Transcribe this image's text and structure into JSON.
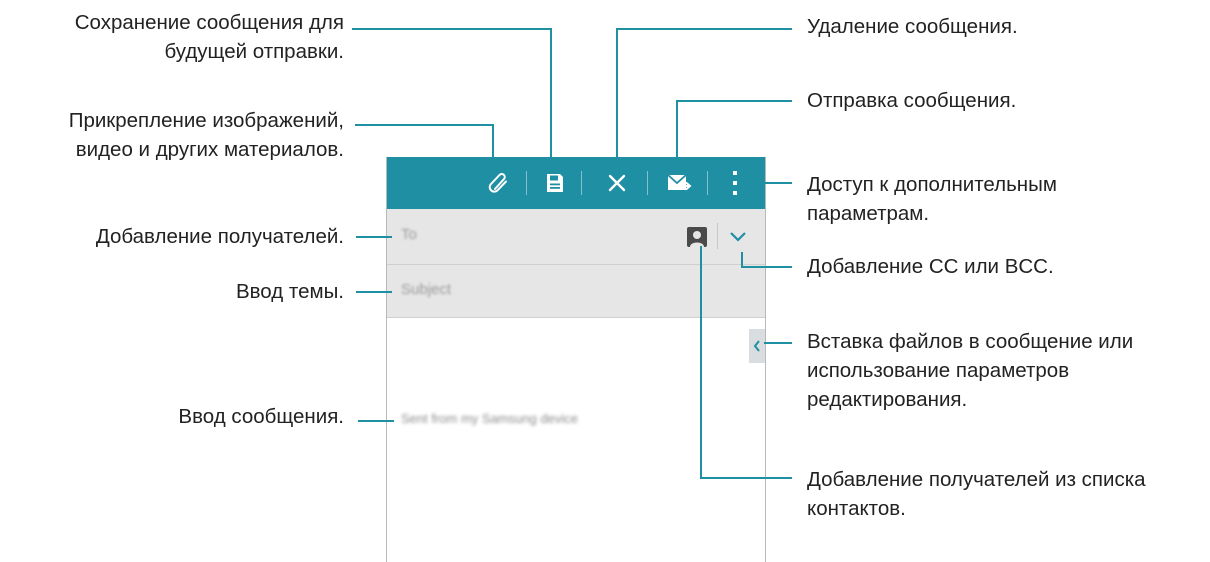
{
  "screen": {
    "to_placeholder": "To",
    "subject_placeholder": "Subject",
    "body_signature": "Sent from my Samsung device"
  },
  "callouts": {
    "save": [
      "Сохранение сообщения для",
      "будущей отправки."
    ],
    "attach": [
      "Прикрепление изображений,",
      "видео и других материалов."
    ],
    "recipients": "Добавление получателей.",
    "subject": "Ввод темы.",
    "message": "Ввод сообщения.",
    "delete": "Удаление сообщения.",
    "send": "Отправка сообщения.",
    "more": [
      "Доступ к дополнительным",
      "параметрам."
    ],
    "cc_bcc": "Добавление CC или BCC.",
    "insert": [
      "Вставка файлов в сообщение или",
      "использование параметров",
      "редактирования."
    ],
    "contacts": [
      "Добавление получателей из списка",
      "контактов."
    ]
  },
  "icons": {
    "attach": "paperclip-icon",
    "save": "save-draft-icon",
    "delete": "close-icon",
    "send": "send-mail-icon",
    "more": "more-vertical-icon",
    "contacts": "contact-card-icon",
    "cc_bcc": "chevron-down-icon",
    "insert": "chevron-left-icon"
  },
  "colors": {
    "accent": "#1f8fa3",
    "toolbar": "#1f8fa3",
    "field_bg": "#e6e6e6"
  }
}
